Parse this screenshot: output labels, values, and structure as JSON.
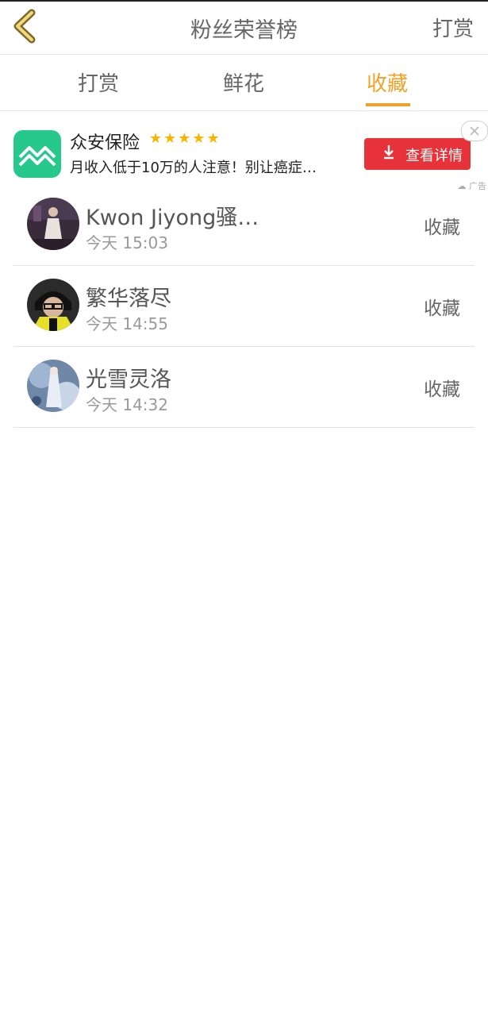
{
  "header": {
    "title": "粉丝荣誉榜",
    "action": "打赏"
  },
  "tabs": [
    {
      "label": "打赏",
      "active": false
    },
    {
      "label": "鲜花",
      "active": false
    },
    {
      "label": "收藏",
      "active": true
    }
  ],
  "ad": {
    "title": "众安保险",
    "stars": "★★★★★",
    "description": "月收入低于10万的人注意！别让癌症…",
    "button_label": "查看详情",
    "mark": "广告"
  },
  "list": [
    {
      "name": "Kwon Jiyong骚…",
      "time": "今天 15:03",
      "action": "收藏"
    },
    {
      "name": "繁华落尽",
      "time": "今天 14:55",
      "action": "收藏"
    },
    {
      "name": "光雪灵洛",
      "time": "今天 14:32",
      "action": "收藏"
    }
  ],
  "colors": {
    "accent": "#f0a127",
    "ad_button": "#e8323a",
    "ad_icon": "#26c88c"
  }
}
